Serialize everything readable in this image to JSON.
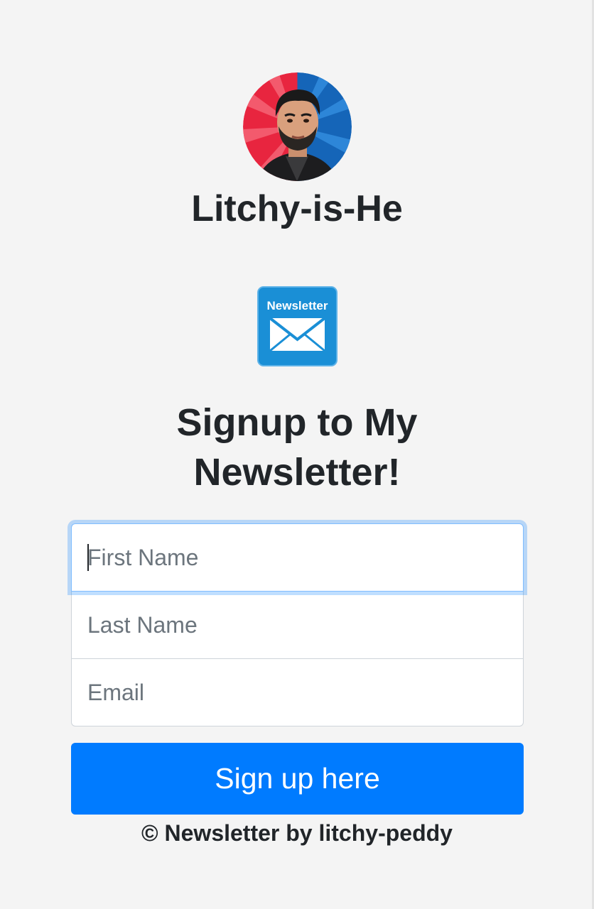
{
  "profile": {
    "name": "Litchy-is-He",
    "avatar_icon": "avatar-portrait-icon"
  },
  "logo": {
    "label": "Newsletter",
    "icon": "envelope-icon",
    "color": "#1a8fd6"
  },
  "heading": {
    "line1": "Signup to My",
    "line2": "Newsletter!"
  },
  "form": {
    "first_name": {
      "placeholder": "First Name",
      "value": ""
    },
    "last_name": {
      "placeholder": "Last Name",
      "value": ""
    },
    "email": {
      "placeholder": "Email",
      "value": ""
    },
    "submit_label": "Sign up here"
  },
  "footer": {
    "text": "© Newsletter by litchy-peddy"
  },
  "colors": {
    "background": "#f4f4f4",
    "primary": "#007bff",
    "text": "#212529",
    "placeholder": "#6c757d",
    "focus_ring": "#80bdff"
  }
}
